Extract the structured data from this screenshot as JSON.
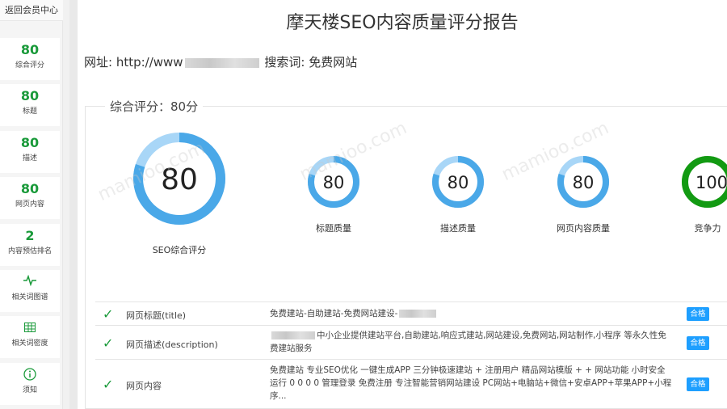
{
  "sidebar": {
    "back_label": "返回会员中心",
    "items": [
      {
        "value": "80",
        "label": "综合评分"
      },
      {
        "value": "80",
        "label": "标题"
      },
      {
        "value": "80",
        "label": "描述"
      },
      {
        "value": "80",
        "label": "网页内容"
      },
      {
        "value": "2",
        "label": "内容预估排名"
      },
      {
        "icon": "pulse-icon",
        "label": "相关词图谱"
      },
      {
        "icon": "grid-icon",
        "label": "相关词密度"
      },
      {
        "icon": "info-icon",
        "label": "须知"
      }
    ]
  },
  "report": {
    "title": "摩天楼SEO内容质量评分报告",
    "url_prefix": "网址: http://www",
    "url_suffix": "搜索词: 免费网站",
    "section_legend": "综合评分：80分"
  },
  "gauges": [
    {
      "value": "80",
      "label": "SEO综合评分",
      "fraction": 0.8,
      "color": "#4aa8e8"
    },
    {
      "value": "80",
      "label": "标题质量",
      "fraction": 0.8,
      "color": "#4aa8e8"
    },
    {
      "value": "80",
      "label": "描述质量",
      "fraction": 0.8,
      "color": "#4aa8e8"
    },
    {
      "value": "80",
      "label": "网页内容质量",
      "fraction": 0.8,
      "color": "#4aa8e8"
    },
    {
      "value": "100",
      "label": "竞争力",
      "fraction": 1.0,
      "color": "#129a12"
    }
  ],
  "checks": [
    {
      "name": "网页标题(title)",
      "desc": "免费建站-自助建站-免费网站建设-",
      "status": "合格"
    },
    {
      "name": "网页描述(description)",
      "desc": "中小企业提供建站平台,自助建站,响应式建站,网站建设,免费网站,网站制作,小程序 等永久性免费建站服务",
      "status": "合格"
    },
    {
      "name": "网页内容",
      "desc": "免费建站 专业SEO优化 一键生成APP 三分钟极速建站 + 注册用户 精品网站模版 + + 网站功能 小时安全运行 0 0 0 0 管理登录 免费注册 专注智能营销网站建设 PC网站+电脑站+微信+安卓APP+苹果APP+小程序...",
      "status": "合格"
    }
  ],
  "colors": {
    "accent_green": "#1a9a3a",
    "badge_blue": "#1e9fff",
    "ring_blue": "#4aa8e8",
    "ring_green": "#129a12"
  }
}
